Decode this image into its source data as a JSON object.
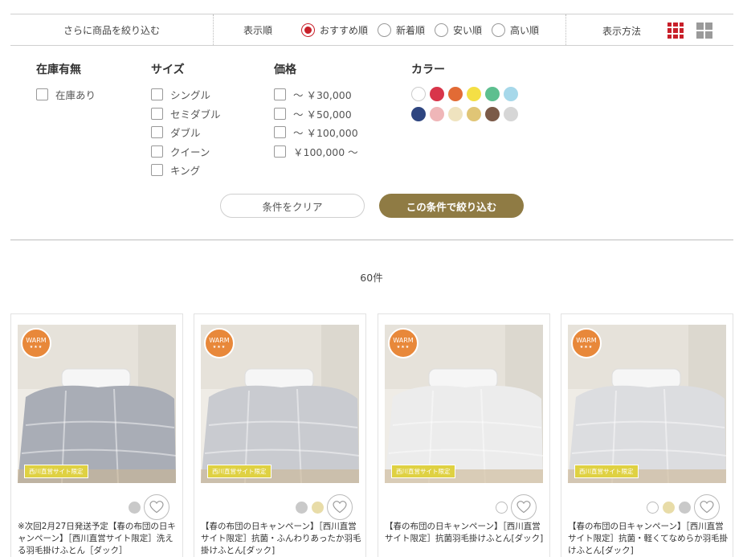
{
  "topbar": {
    "filter_label": "さらに商品を絞り込む",
    "sort_label": "表示順",
    "sort_options": [
      {
        "label": "おすすめ順",
        "selected": true
      },
      {
        "label": "新着順",
        "selected": false
      },
      {
        "label": "安い順",
        "selected": false
      },
      {
        "label": "高い順",
        "selected": false
      }
    ],
    "view_label": "表示方法"
  },
  "filters": {
    "stock": {
      "title": "在庫有無",
      "options": [
        "在庫あり"
      ]
    },
    "size": {
      "title": "サイズ",
      "options": [
        "シングル",
        "セミダブル",
        "ダブル",
        "クイーン",
        "キング"
      ]
    },
    "price": {
      "title": "価格",
      "options": [
        "～ ￥30,000",
        "～ ￥50,000",
        "～ ￥100,000",
        "￥100,000 ～"
      ]
    },
    "color": {
      "title": "カラー",
      "swatches": [
        "#ffffff",
        "#d8354a",
        "#e26b35",
        "#f4df45",
        "#5dbf8f",
        "#a6d8ea",
        "#2e4580",
        "#efb6b8",
        "#efe3bf",
        "#e0c576",
        "#7b5a47",
        "#d6d6d6"
      ]
    }
  },
  "buttons": {
    "clear": "条件をクリア",
    "apply": "この条件で絞り込む"
  },
  "result_count": "60件",
  "colors": {
    "accent": "#c8202a",
    "apply_button": "#8f7b44"
  },
  "products": [
    {
      "badge": "WARM",
      "badge_stars": "★★★",
      "site_badge": "西川直営サイト限定",
      "title": "※次回2月27日発送予定【春の布団の日キャンペーン】［西川直営サイト限定］洗える羽毛掛けふとん［ダック］",
      "colors": [
        "#c9c9c9"
      ],
      "fill": "#a9adb6"
    },
    {
      "badge": "WARM",
      "badge_stars": "★★★",
      "site_badge": "西川直営サイト限定",
      "title": "【春の布団の日キャンペーン】［西川直営サイト限定］抗菌・ふんわりあったか羽毛掛けふとん[ダック]",
      "colors": [
        "#c9c9c9",
        "#e8dca8"
      ],
      "fill": "#c9cbd0"
    },
    {
      "badge": "WARM",
      "badge_stars": "★★★",
      "site_badge": "西川直営サイト限定",
      "title": "【春の布団の日キャンペーン】［西川直営サイト限定］抗菌羽毛掛けふとん[ダック]",
      "colors": [
        "#ffffff"
      ],
      "fill": "#ececec"
    },
    {
      "badge": "WARM",
      "badge_stars": "★★★",
      "site_badge": "西川直営サイト限定",
      "title": "【春の布団の日キャンペーン】［西川直営サイト限定］抗菌・軽くてなめらか羽毛掛けふとん[ダック]",
      "colors": [
        "#ffffff",
        "#e8dca8",
        "#c9c9c9"
      ],
      "fill": "#dcdde0"
    }
  ]
}
